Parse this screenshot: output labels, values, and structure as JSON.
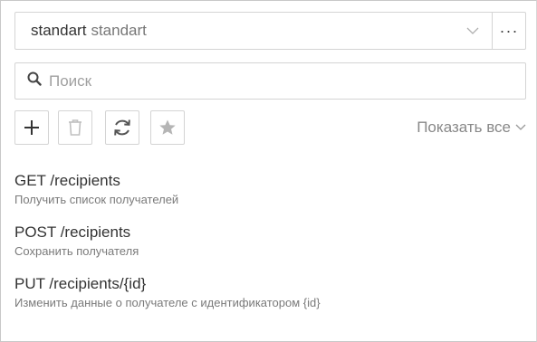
{
  "environment": {
    "name": "standart",
    "label": "standart",
    "more_label": "···"
  },
  "search": {
    "placeholder": "Поиск"
  },
  "toolbar": {
    "show_all_label": "Показать все"
  },
  "colors": {
    "text": "#333333",
    "muted": "#888888",
    "border": "#d4d4d4",
    "disabled_icon": "#c0c0c0"
  },
  "endpoints": [
    {
      "title": "GET /recipients",
      "description": "Получить список получателей"
    },
    {
      "title": "POST /recipients",
      "description": "Сохранить получателя"
    },
    {
      "title": "PUT /recipients/{id}",
      "description": "Изменить данные о получателе с идентификатором {id}"
    }
  ]
}
